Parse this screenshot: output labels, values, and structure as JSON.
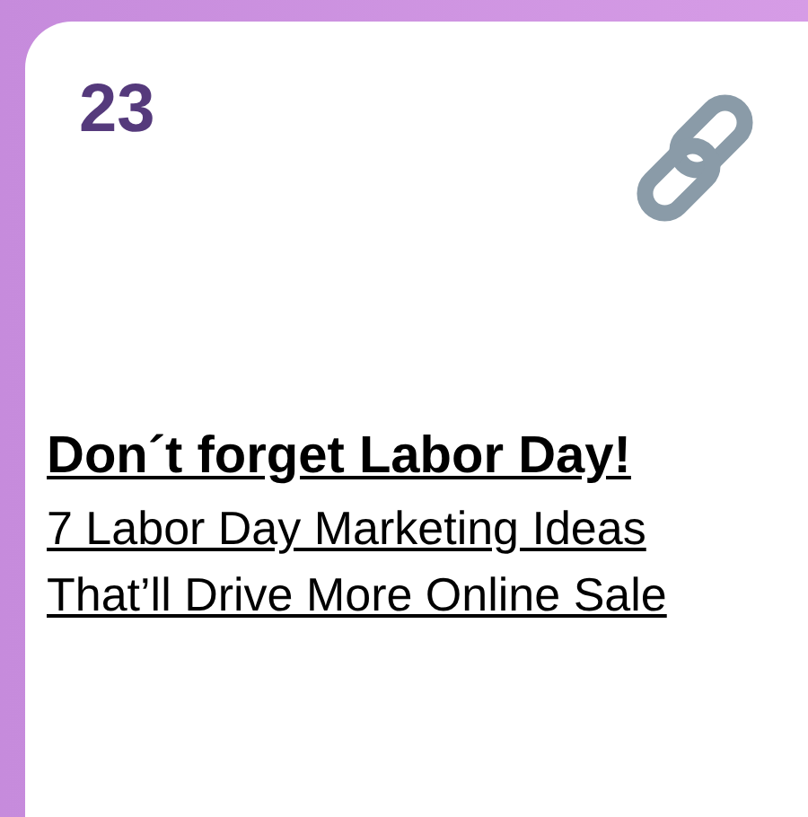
{
  "card": {
    "number": "23",
    "title": "Don´t forget Labor Day!",
    "link_lines": [
      "7 Labor Day Marketing Ideas",
      "That’ll Drive More Online Sale"
    ]
  }
}
